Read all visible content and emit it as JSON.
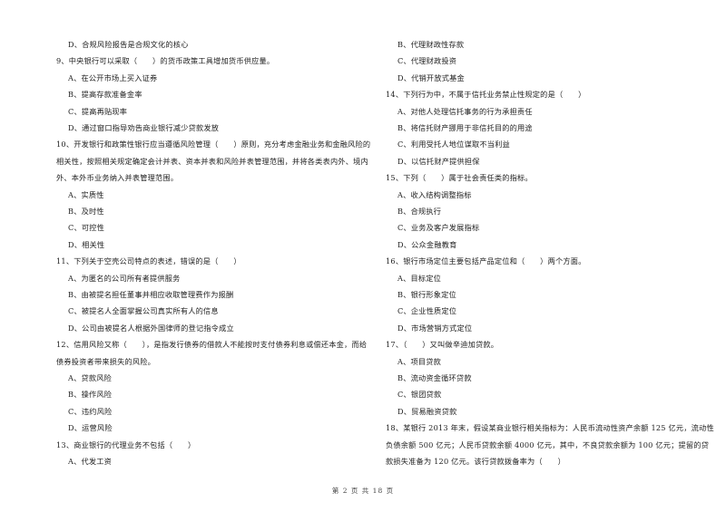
{
  "left_column": [
    {
      "kind": "option",
      "text": "D、合规风险报告是合规文化的核心"
    },
    {
      "kind": "question",
      "text": "9、中央银行可以采取（　　）的货币政策工具增加货币供应量。"
    },
    {
      "kind": "option",
      "text": "A、在公开市场上买入证券"
    },
    {
      "kind": "option",
      "text": "B、提高存款准备金率"
    },
    {
      "kind": "option",
      "text": "C、提高再贴现率"
    },
    {
      "kind": "option",
      "text": "D、通过窗口指导劝告商业银行减少贷款发放"
    },
    {
      "kind": "question",
      "text": "10、开发银行和政策性银行应当遵循风险管理（　　）原则，充分考虑金融业务和金融风险的"
    },
    {
      "kind": "question-cont",
      "text": "相关性，按照相关规定确定会计并表、资本并表和风险并表管理范围，并将各类表内外、境内"
    },
    {
      "kind": "question-cont",
      "text": "外、本外币业务纳入并表管理范围。"
    },
    {
      "kind": "option",
      "text": "A、实质性"
    },
    {
      "kind": "option",
      "text": "B、及时性"
    },
    {
      "kind": "option",
      "text": "C、可控性"
    },
    {
      "kind": "option",
      "text": "D、相关性"
    },
    {
      "kind": "question",
      "text": "11、下列关于空壳公司特点的表述，错误的是（　　）"
    },
    {
      "kind": "option",
      "text": "A、为匿名的公司所有者提供服务"
    },
    {
      "kind": "option",
      "text": "B、由被提名担任董事并相应收取管理费作为报酬"
    },
    {
      "kind": "option",
      "text": "C、被提名人全面掌握公司真实所有人的信息"
    },
    {
      "kind": "option",
      "text": "D、公司由被提名人根据外国律师的登记指令成立"
    },
    {
      "kind": "question",
      "text": "12、信用风险又称（　　），是指发行债券的借款人不能按时支付债券利息或偿还本金，而给"
    },
    {
      "kind": "question-cont",
      "text": "债券投资者带来损失的风险。"
    },
    {
      "kind": "option",
      "text": "A、贷款风险"
    },
    {
      "kind": "option",
      "text": "B、操作风险"
    },
    {
      "kind": "option",
      "text": "C、违约风险"
    },
    {
      "kind": "option",
      "text": "D、运营风险"
    },
    {
      "kind": "question",
      "text": "13、商业银行的代理业务不包括（　　）"
    },
    {
      "kind": "option",
      "text": "A、代发工资"
    }
  ],
  "right_column": [
    {
      "kind": "option",
      "text": "B、代理财政性存款"
    },
    {
      "kind": "option",
      "text": "C、代理财政投资"
    },
    {
      "kind": "option",
      "text": "D、代销开放式基金"
    },
    {
      "kind": "question",
      "text": "14、下列行为中，不属于信托业务禁止性规定的是（　　）"
    },
    {
      "kind": "option",
      "text": "A、对他人处理信托事务的行为承担责任"
    },
    {
      "kind": "option",
      "text": "B、将信托财产挪用于非信托目的的用途"
    },
    {
      "kind": "option",
      "text": "C、利用受托人地位谋取不当利益"
    },
    {
      "kind": "option",
      "text": "D、以信托财产提供担保"
    },
    {
      "kind": "question",
      "text": "15、下列（　　）属于社会责任类的指标。"
    },
    {
      "kind": "option",
      "text": "A、收入结构调整指标"
    },
    {
      "kind": "option",
      "text": "B、合规执行"
    },
    {
      "kind": "option",
      "text": "C、业务及客户发展指标"
    },
    {
      "kind": "option",
      "text": "D、公众金融教育"
    },
    {
      "kind": "question",
      "text": "16、银行市场定位主要包括产品定位和（　　）两个方面。"
    },
    {
      "kind": "option",
      "text": "A、目标定位"
    },
    {
      "kind": "option",
      "text": "B、银行形象定位"
    },
    {
      "kind": "option",
      "text": "C、企业性质定位"
    },
    {
      "kind": "option",
      "text": "D、市场营销方式定位"
    },
    {
      "kind": "question",
      "text": "17、（　　）又叫做辛迪加贷款。"
    },
    {
      "kind": "option",
      "text": "A、项目贷款"
    },
    {
      "kind": "option",
      "text": "B、流动资金循环贷款"
    },
    {
      "kind": "option",
      "text": "C、银团贷款"
    },
    {
      "kind": "option",
      "text": "D、贸易融资贷款"
    },
    {
      "kind": "question",
      "text": "18、某银行 2013 年末，假设某商业银行相关指标为：人民币流动性资产余额 125 亿元，流动性"
    },
    {
      "kind": "question-cont",
      "text": "负债余额 500 亿元；人民币贷款余额 4000 亿元，其中，不良贷款余额为 100 亿元；提留的贷"
    },
    {
      "kind": "question-cont",
      "text": "款损失准备为 120 亿元。该行贷款拨备率为（　　）"
    }
  ],
  "footer": {
    "page_label": "第 2 页 共 18 页"
  }
}
